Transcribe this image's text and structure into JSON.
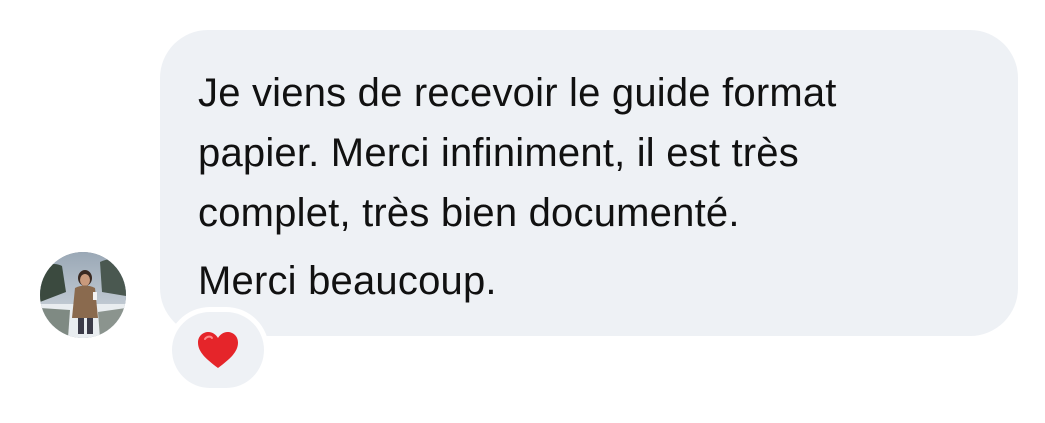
{
  "message": {
    "lines": [
      "Je viens de recevoir le guide format",
      "papier. Merci infiniment, il est très",
      "complet, très bien documenté.",
      "Merci beaucoup."
    ]
  },
  "reaction": {
    "icon": "red-heart-icon",
    "color": "#e5252a"
  },
  "colors": {
    "bubble": "#eef1f5",
    "text": "#111111",
    "background": "#ffffff"
  }
}
